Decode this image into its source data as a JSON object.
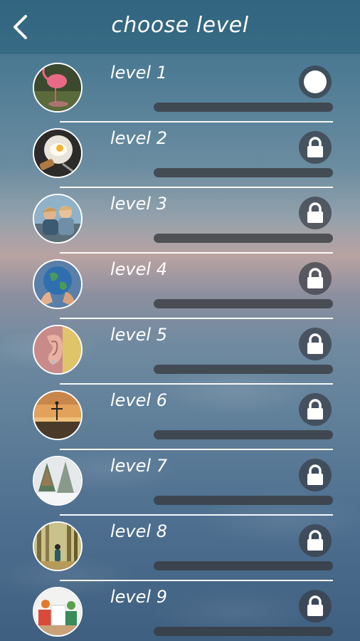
{
  "header": {
    "title": "choose level",
    "back_icon": "chevron-left-icon"
  },
  "colors": {
    "header_bg": "#2f6f86",
    "progress_track": "#3a3d42",
    "text": "#ffffff"
  },
  "levels": [
    {
      "label": "level 1",
      "status": "unlocked",
      "icon": "play-icon",
      "progress": 0,
      "image": "flamingo-icon"
    },
    {
      "label": "level 2",
      "status": "locked",
      "icon": "lock-icon",
      "progress": 0,
      "image": "breakfast-icon"
    },
    {
      "label": "level 3",
      "status": "locked",
      "icon": "lock-icon",
      "progress": 0,
      "image": "children-icon"
    },
    {
      "label": "level 4",
      "status": "locked",
      "icon": "lock-icon",
      "progress": 0,
      "image": "globe-hands-icon"
    },
    {
      "label": "level 5",
      "status": "locked",
      "icon": "lock-icon",
      "progress": 0,
      "image": "ear-icon"
    },
    {
      "label": "level 6",
      "status": "locked",
      "icon": "lock-icon",
      "progress": 0,
      "image": "sunset-person-icon"
    },
    {
      "label": "level 7",
      "status": "locked",
      "icon": "lock-icon",
      "progress": 0,
      "image": "snowy-trees-icon"
    },
    {
      "label": "level 8",
      "status": "locked",
      "icon": "lock-icon",
      "progress": 0,
      "image": "forest-hiker-icon"
    },
    {
      "label": "level 9",
      "status": "locked",
      "icon": "lock-icon",
      "progress": 0,
      "image": "gifts-icon"
    }
  ]
}
